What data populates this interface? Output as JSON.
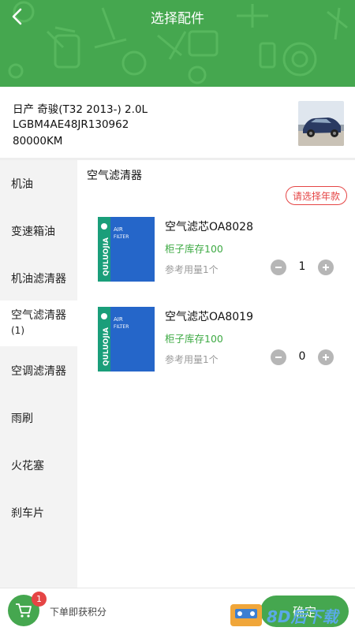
{
  "header": {
    "title": "选择配件"
  },
  "car": {
    "model": "日产 奇骏(T32 2013-) 2.0L",
    "vin": "LGBM4AE48JR130962",
    "mileage": "80000KM"
  },
  "sidebar": {
    "items": [
      {
        "label": "机油"
      },
      {
        "label": "变速箱油"
      },
      {
        "label": "机油滤清器"
      },
      {
        "label": "空气滤清器",
        "count": "(1)",
        "active": true
      },
      {
        "label": "空调滤清器"
      },
      {
        "label": "雨刷"
      },
      {
        "label": "火花塞"
      },
      {
        "label": "刹车片"
      }
    ]
  },
  "content": {
    "category_title": "空气滤清器",
    "year_button": "请选择年款",
    "products": [
      {
        "name": "空气滤芯OA8028",
        "stock": "柜子库存100",
        "ref_usage": "参考用量1个",
        "quantity": "1",
        "box_text_main": "AIR",
        "box_text_sub": "FILTER",
        "box_brand": "QULUOJIA"
      },
      {
        "name": "空气滤芯OA8019",
        "stock": "柜子库存100",
        "ref_usage": "参考用量1个",
        "quantity": "0",
        "box_text_main": "AIR",
        "box_text_sub": "FILTER",
        "box_brand": "QULUOJIA"
      }
    ]
  },
  "footer": {
    "cart_badge": "1",
    "points_text": "下单即获积分",
    "confirm_label": "确定"
  },
  "watermark": {
    "text": "8D后下载"
  },
  "colors": {
    "primary": "#45a74f",
    "accent_red": "#e54545",
    "stock_green": "#3eaa44"
  }
}
